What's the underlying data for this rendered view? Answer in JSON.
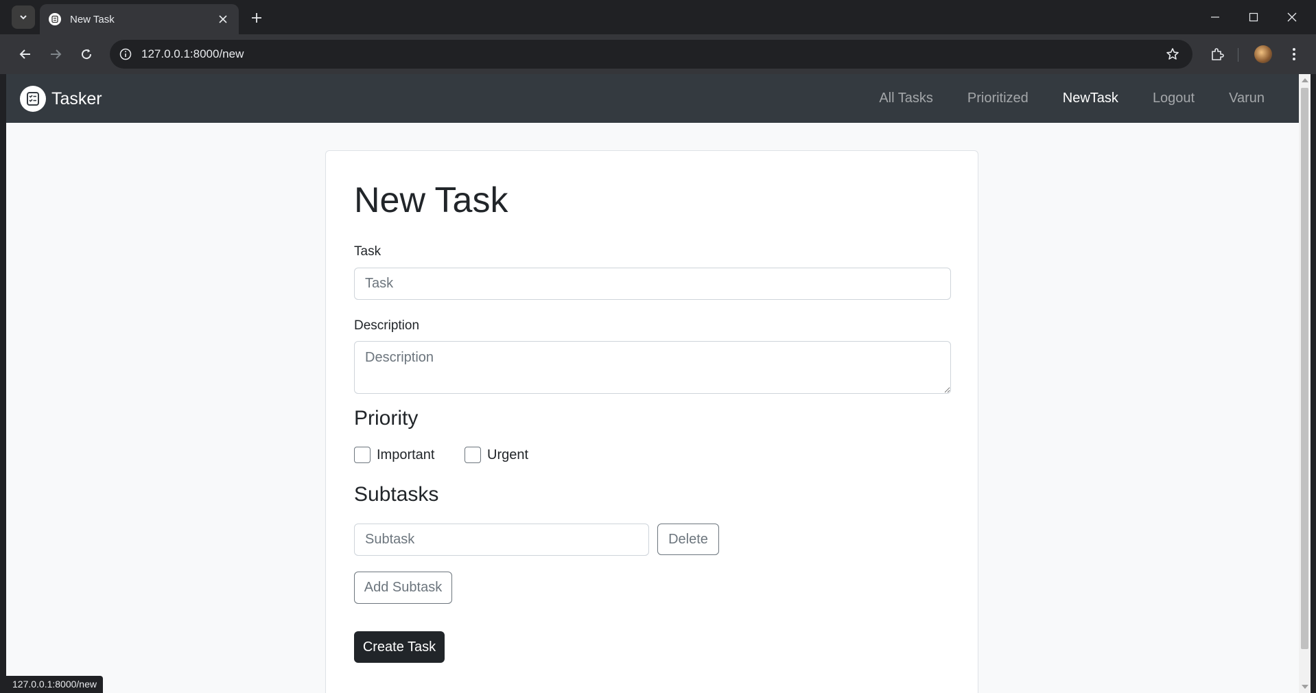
{
  "browser": {
    "tab_title": "New Task",
    "url": "127.0.0.1:8000/new",
    "status_url": "127.0.0.1:8000/new"
  },
  "app": {
    "brand": "Tasker",
    "nav": [
      {
        "label": "All Tasks",
        "active": false
      },
      {
        "label": "Prioritized",
        "active": false
      },
      {
        "label": "NewTask",
        "active": true
      },
      {
        "label": "Logout",
        "active": false
      },
      {
        "label": "Varun",
        "active": false
      }
    ]
  },
  "form": {
    "heading": "New Task",
    "task_label": "Task",
    "task_placeholder": "Task",
    "task_value": "",
    "description_label": "Description",
    "description_placeholder": "Description",
    "description_value": "",
    "priority_heading": "Priority",
    "important_label": "Important",
    "important_checked": false,
    "urgent_label": "Urgent",
    "urgent_checked": false,
    "subtasks_heading": "Subtasks",
    "subtask_placeholder": "Subtask",
    "delete_label": "Delete",
    "add_subtask_label": "Add Subtask",
    "create_label": "Create Task"
  },
  "colors": {
    "navbar_bg": "#343a40",
    "page_bg": "#f8f9fa",
    "primary_dark": "#212529",
    "muted": "#6c757d"
  }
}
